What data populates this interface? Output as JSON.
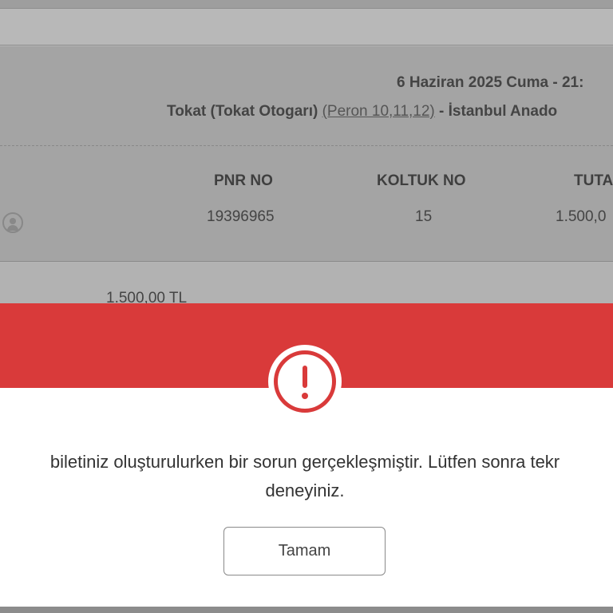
{
  "trip": {
    "date_time": "6 Haziran 2025 Cuma - 21:",
    "route_from": "Tokat (Tokat Otogarı)",
    "peron": "(Peron 10,11,12)",
    "route_to": " - İstanbul Anado"
  },
  "ticket_table": {
    "headers": {
      "pnr": "PNR NO",
      "seat": "KOLTUK NO",
      "amount": "TUTA"
    },
    "row": {
      "pnr": "19396965",
      "seat": "15",
      "amount": "1.500,0"
    }
  },
  "total": "1.500,00 TL",
  "modal": {
    "message_line1": "biletiniz oluşturulurken bir sorun gerçekleşmiştir. Lütfen sonra tekr",
    "message_line2": "deneyiniz.",
    "ok_label": "Tamam",
    "icon": "exclamation-circle-icon"
  },
  "colors": {
    "accent_red": "#d93a3a",
    "overlay_gray": "#a4a4a4"
  }
}
